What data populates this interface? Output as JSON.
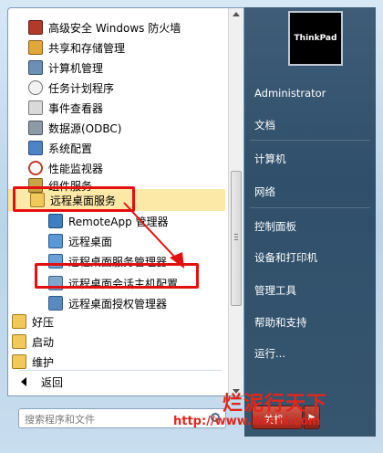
{
  "left_pane": {
    "items": [
      {
        "label": "高级安全 Windows 防火墙",
        "icon": "firewall-icon"
      },
      {
        "label": "共享和存储管理",
        "icon": "storage-icon"
      },
      {
        "label": "计算机管理",
        "icon": "computer-management-icon"
      },
      {
        "label": "任务计划程序",
        "icon": "clock-icon"
      },
      {
        "label": "事件查看器",
        "icon": "event-viewer-icon"
      },
      {
        "label": "数据源(ODBC)",
        "icon": "database-icon"
      },
      {
        "label": "系统配置",
        "icon": "system-config-icon"
      },
      {
        "label": "性能监视器",
        "icon": "performance-icon"
      },
      {
        "label": "组件服务",
        "icon": "component-services-icon"
      },
      {
        "label": "远程桌面服务",
        "icon": "folder-icon"
      },
      {
        "label": "RemoteApp 管理器",
        "icon": "remoteapp-icon"
      },
      {
        "label": "远程桌面",
        "icon": "remote-desktop-icon"
      },
      {
        "label": "远程桌面服务管理器",
        "icon": "rds-manager-icon"
      },
      {
        "label": "远程桌面会话主机配置",
        "icon": "session-host-icon"
      },
      {
        "label": "远程桌面授权管理器",
        "icon": "licensing-icon"
      },
      {
        "label": "好压",
        "icon": "folder-icon"
      },
      {
        "label": "启动",
        "icon": "folder-icon"
      },
      {
        "label": "维护",
        "icon": "folder-icon"
      }
    ],
    "back_label": "返回",
    "search_placeholder": "搜索程序和文件"
  },
  "right_pane": {
    "brand": "ThinkPad",
    "items": [
      "Administrator",
      "文档",
      "计算机",
      "网络",
      "控制面板",
      "设备和打印机",
      "管理工具",
      "帮助和支持",
      "运行..."
    ],
    "shutdown_label": "关机"
  },
  "watermark": {
    "title": "烂泥行天下",
    "url": "http://www.ilanni.com"
  },
  "colors": {
    "highlight": "#e31010",
    "selected_bg": "#fde9a7",
    "right_pane_bg": "#2f4f6b"
  }
}
